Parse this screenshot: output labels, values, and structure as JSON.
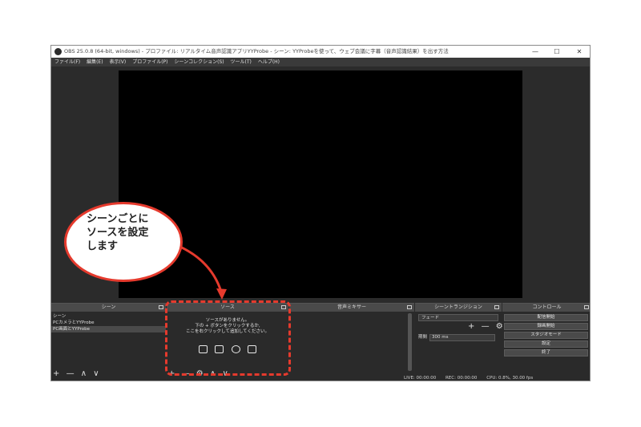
{
  "window": {
    "title": "OBS 25.0.8 (64-bit, windows) - プロファイル: リアルタイム音声認識アプリYYProbe - シーン: YYProbeを使って、ウェブ会議に字幕（音声認識結果）を出す方法",
    "minimize_glyph": "—",
    "maximize_glyph": "☐",
    "close_glyph": "✕"
  },
  "menu": [
    "ファイル(F)",
    "編集(E)",
    "表示(V)",
    "プロファイル(P)",
    "シーンコレクション(S)",
    "ツール(T)",
    "ヘルプ(H)"
  ],
  "scenes": {
    "header": "シーン",
    "items": [
      "シーン",
      "PCカメラとYYProbe",
      "PC画面とYYProbe"
    ],
    "selected_index": 2,
    "toolbar": [
      "+",
      "—",
      "∧",
      "∨"
    ]
  },
  "sources": {
    "header": "ソース",
    "empty_lines": [
      "ソースがありません。",
      "下の + ボタンをクリックするか,",
      "ここを右クリックして追加してください。"
    ],
    "type_icons": [
      "image-icon",
      "monitor-icon",
      "browser-icon",
      "camera-icon"
    ],
    "toolbar": [
      "+",
      "—",
      "⚙",
      "∧",
      "∨"
    ]
  },
  "mixer": {
    "header": "音声ミキサー"
  },
  "transitions": {
    "header": "シーントランジション",
    "selected": "フェード",
    "toolbar": [
      "+",
      "—",
      "⚙"
    ],
    "duration_label": "期間",
    "duration_value": "300 ms"
  },
  "controls": {
    "header": "コントロール",
    "buttons": [
      "配信開始",
      "録画開始",
      "スタジオモード",
      "設定",
      "終了"
    ]
  },
  "status": {
    "live": "LIVE: 00:00:00",
    "rec": "REC: 00:00:00",
    "cpu": "CPU: 0.8%, 30.00 fps"
  },
  "callout": {
    "text": "シーンごとに\nソースを設定\nします",
    "color": "#e53a2d"
  }
}
